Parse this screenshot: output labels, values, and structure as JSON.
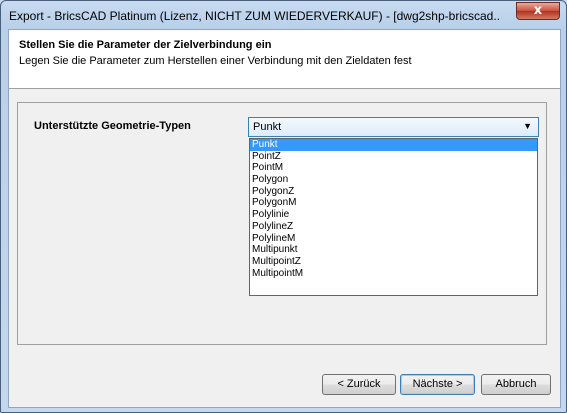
{
  "window": {
    "title": "Export - BricsCAD Platinum (Lizenz, NICHT ZUM WIEDERVERKAUF) - [dwg2shp-bricscad...",
    "close_label": "x"
  },
  "header": {
    "title": "Stellen Sie die Parameter der Zielverbindung ein",
    "subtitle": "Legen Sie die Parameter zum Herstellen einer Verbindung mit den Zieldaten fest"
  },
  "geometry": {
    "label": "Unterstützte Geometrie-Typen",
    "selected": "Punkt",
    "options": [
      "Punkt",
      "PointZ",
      "PointM",
      "Polygon",
      "PolygonZ",
      "PolygonM",
      "Polylinie",
      "PolylineZ",
      "PolylineM",
      "Multipunkt",
      "MultipointZ",
      "MultipointM"
    ]
  },
  "buttons": {
    "back": "< Zurück",
    "next": "Nächste >",
    "cancel": "Abbruch"
  },
  "colors": {
    "selection": "#3399ff",
    "accent_border": "#3c7fb1"
  }
}
